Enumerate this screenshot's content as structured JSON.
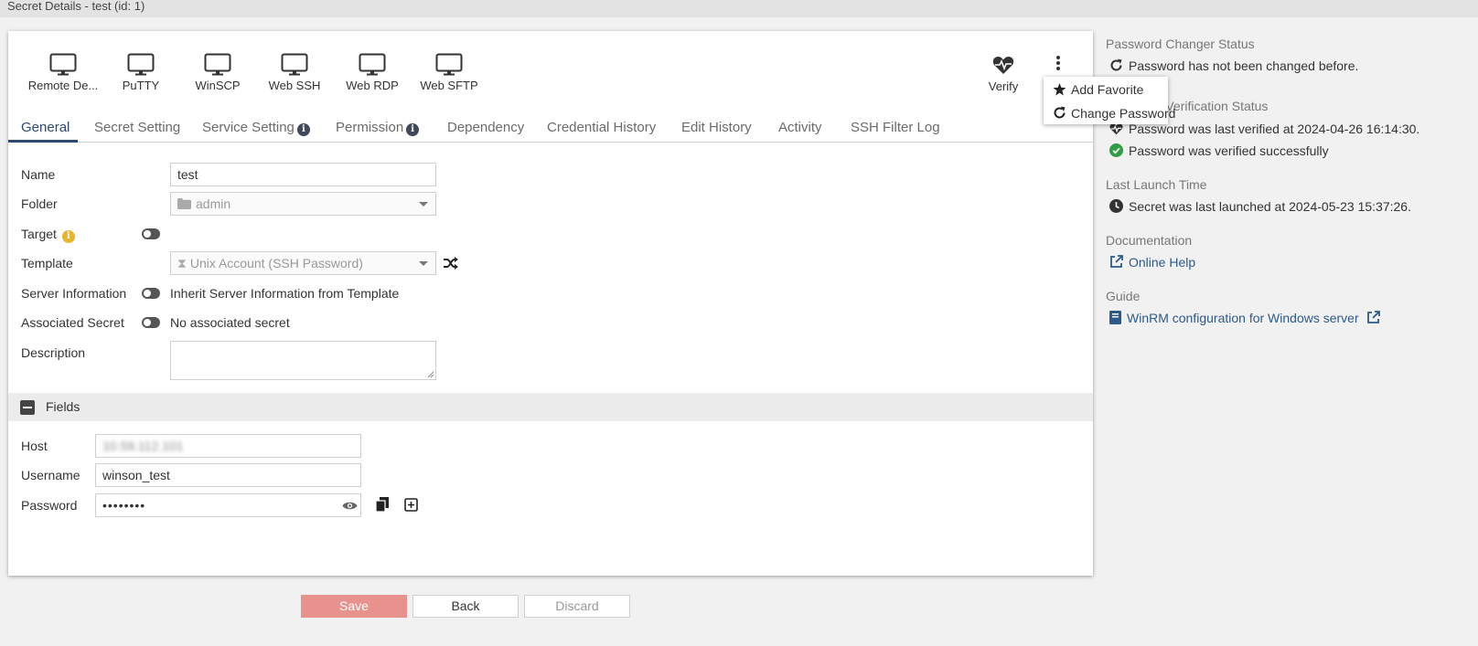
{
  "title": "Secret Details - test (id: 1)",
  "toolbar": {
    "launchers": [
      "Remote De...",
      "PuTTY",
      "WinSCP",
      "Web SSH",
      "Web RDP",
      "Web SFTP"
    ],
    "verify_label": "Verify"
  },
  "menu": {
    "add_favorite": "Add Favorite",
    "change_password": "Change Password"
  },
  "tabs": [
    "General",
    "Secret Setting",
    "Service Setting",
    "Permission",
    "Dependency",
    "Credential History",
    "Edit History",
    "Activity",
    "SSH Filter Log"
  ],
  "general": {
    "name_label": "Name",
    "name_value": "test",
    "folder_label": "Folder",
    "folder_value": "admin",
    "target_label": "Target",
    "template_label": "Template",
    "template_value": "Unix Account (SSH Password)",
    "server_info_label": "Server Information",
    "server_info_text": "Inherit Server Information from Template",
    "assoc_label": "Associated Secret",
    "assoc_text": "No associated secret",
    "description_label": "Description"
  },
  "fields": {
    "title": "Fields",
    "host_label": "Host",
    "host_value": "10.59.112.101",
    "username_label": "Username",
    "username_value": "winson_test",
    "password_label": "Password",
    "password_value": "••••••••"
  },
  "sidebar": {
    "pcs_title": "Password Changer Status",
    "pcs_text": "Password has not been changed before.",
    "pvs_title": "Password Verification Status",
    "pvs_last": "Password was last verified at 2024-04-26 16:14:30.",
    "pvs_success": "Password was verified successfully",
    "llt_title": "Last Launch Time",
    "llt_text": "Secret was last launched at 2024-05-23 15:37:26.",
    "doc_title": "Documentation",
    "doc_link": "Online Help",
    "guide_title": "Guide",
    "guide_link": "WinRM configuration for Windows server"
  },
  "buttons": {
    "save": "Save",
    "back": "Back",
    "discard": "Discard"
  },
  "colors": {
    "accent": "#2c4a6b",
    "save": "#e8928d",
    "success": "#2e9e45",
    "link": "#2c5a8a"
  }
}
